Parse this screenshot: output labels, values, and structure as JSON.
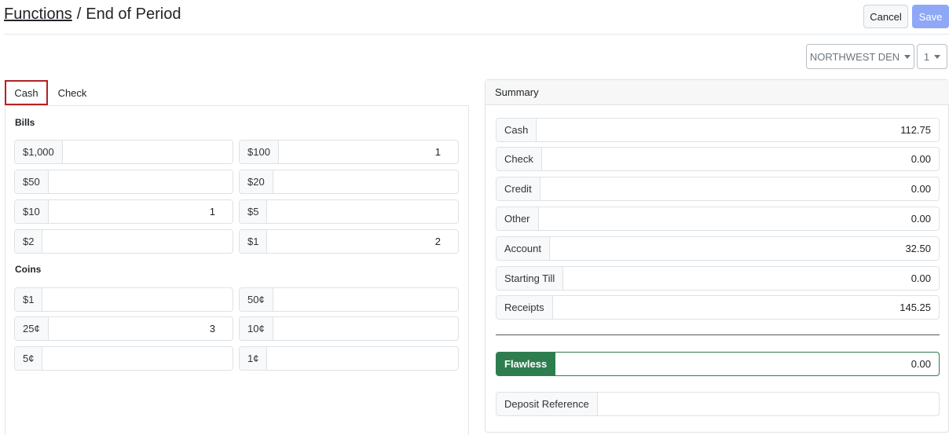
{
  "header": {
    "breadcrumb_link": "Functions",
    "separator": "/",
    "page_title": "End of Period",
    "cancel_label": "Cancel",
    "save_label": "Save",
    "branch_select": "NORTHWEST DEN",
    "number_select": "1"
  },
  "tabs": {
    "cash": "Cash",
    "check": "Check"
  },
  "bills": {
    "label": "Bills",
    "fields": [
      {
        "label": "$1,000",
        "value": ""
      },
      {
        "label": "$100",
        "value": "1"
      },
      {
        "label": "$50",
        "value": ""
      },
      {
        "label": "$20",
        "value": ""
      },
      {
        "label": "$10",
        "value": "1"
      },
      {
        "label": "$5",
        "value": ""
      },
      {
        "label": "$2",
        "value": ""
      },
      {
        "label": "$1",
        "value": "2"
      }
    ]
  },
  "coins": {
    "label": "Coins",
    "fields": [
      {
        "label": "$1",
        "value": ""
      },
      {
        "label": "50¢",
        "value": ""
      },
      {
        "label": "25¢",
        "value": "3"
      },
      {
        "label": "10¢",
        "value": ""
      },
      {
        "label": "5¢",
        "value": ""
      },
      {
        "label": "1¢",
        "value": ""
      }
    ]
  },
  "summary": {
    "title": "Summary",
    "rows": [
      {
        "label": "Cash",
        "value": "112.75"
      },
      {
        "label": "Check",
        "value": "0.00"
      },
      {
        "label": "Credit",
        "value": "0.00"
      },
      {
        "label": "Other",
        "value": "0.00"
      },
      {
        "label": "Account",
        "value": "32.50"
      },
      {
        "label": "Starting Till",
        "value": "0.00"
      },
      {
        "label": "Receipts",
        "value": "145.25"
      }
    ],
    "flawless": {
      "label": "Flawless",
      "value": "0.00"
    },
    "deposit_reference": {
      "label": "Deposit Reference",
      "value": ""
    }
  },
  "colors": {
    "accent": "#8ea8f7",
    "success": "#2e7d4f",
    "active_tab_border": "#b22222"
  }
}
